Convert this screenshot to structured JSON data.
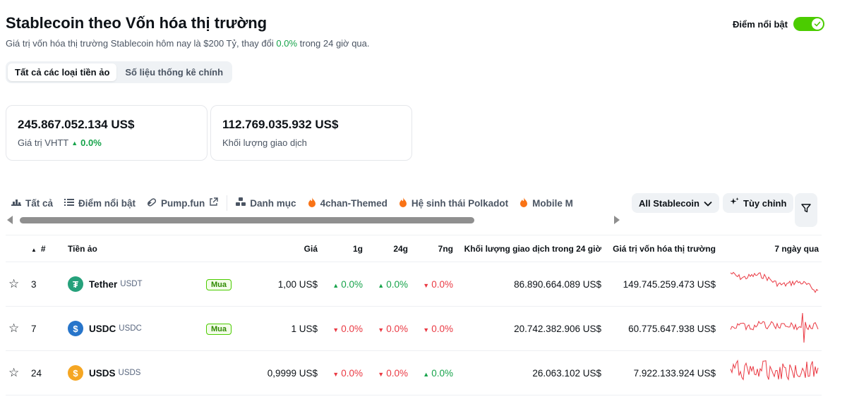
{
  "header": {
    "title": "Stablecoin theo Vốn hóa thị trường",
    "subtitle_before": "Giá trị vốn hóa thị trường Stablecoin hôm nay là $200 Tỷ, thay đổi ",
    "subtitle_change": "0.0%",
    "subtitle_after": " trong 24 giờ qua.",
    "highlight_label": "Điểm nổi bật"
  },
  "segment": [
    "Tất cả các loại tiền ảo",
    "Số liệu thống kê chính"
  ],
  "cards": [
    {
      "value": "245.867.052.134 US$",
      "label": "Giá trị VHTT",
      "change": "0.0%"
    },
    {
      "value": "112.769.035.932 US$",
      "label": "Khối lượng giao dịch"
    }
  ],
  "tabs": [
    {
      "label": "Tất cả",
      "icon": "bar-chart-icon"
    },
    {
      "label": "Điểm nổi bật",
      "icon": "list-icon"
    },
    {
      "label": "Pump.fun",
      "icon": "pill-icon"
    },
    {
      "label": "Danh mục",
      "icon": "blocks-icon"
    },
    {
      "label": "4chan-Themed",
      "icon": "fire-icon"
    },
    {
      "label": "Hệ sinh thái Polkadot",
      "icon": "fire-icon"
    },
    {
      "label": "Mobile M",
      "icon": "fire-icon"
    }
  ],
  "controls": {
    "select_label": "All Stablecoin",
    "customize_label": "Tùy chỉnh"
  },
  "table": {
    "headers": {
      "rank": "#",
      "coin": "Tiền ảo",
      "price": "Giá",
      "h1": "1g",
      "h24": "24g",
      "d7": "7ng",
      "volume": "Khối lượng giao dịch trong 24 giờ",
      "mcap": "Giá trị vốn hóa thị trường",
      "chart": "7 ngày qua"
    },
    "buy_label": "Mua",
    "rows": [
      {
        "rank": "3",
        "name": "Tether",
        "symbol": "USDT",
        "logo": "tether-logo-icon",
        "logo_color": "#26a17b",
        "buy": true,
        "price": "1,00 US$",
        "h1": "0.0%",
        "h1_dir": "up",
        "h24": "0.0%",
        "h24_dir": "up",
        "d7": "0.0%",
        "d7_dir": "down",
        "volume": "86.890.664.089 US$",
        "mcap": "149.745.259.473 US$"
      },
      {
        "rank": "7",
        "name": "USDC",
        "symbol": "USDC",
        "logo": "usdc-logo-icon",
        "logo_color": "#2775ca",
        "buy": true,
        "price": "1 US$",
        "h1": "0.0%",
        "h1_dir": "down",
        "h24": "0.0%",
        "h24_dir": "down",
        "d7": "0.0%",
        "d7_dir": "down",
        "volume": "20.742.382.906 US$",
        "mcap": "60.775.647.938 US$"
      },
      {
        "rank": "24",
        "name": "USDS",
        "symbol": "USDS",
        "logo": "usds-logo-icon",
        "logo_color": "#f5a623",
        "buy": false,
        "price": "0,9999 US$",
        "h1": "0.0%",
        "h1_dir": "down",
        "h24": "0.0%",
        "h24_dir": "down",
        "d7": "0.0%",
        "d7_dir": "up",
        "volume": "26.063.102 US$",
        "mcap": "7.922.133.924 US$"
      }
    ]
  },
  "colors": {
    "up": "#16a34a",
    "down": "#ea3943",
    "brand_green": "#4bcc00",
    "sparkline": "#ea3943"
  }
}
